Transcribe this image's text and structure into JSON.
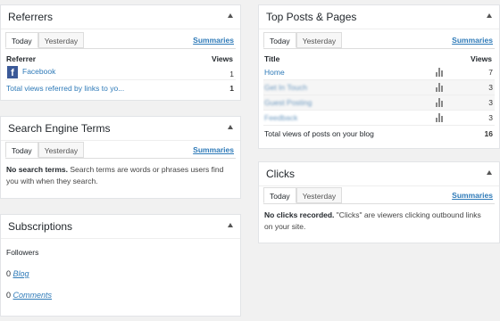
{
  "referrers": {
    "title": "Referrers",
    "tabs": [
      "Today",
      "Yesterday"
    ],
    "summaries": "Summaries",
    "col_referrer": "Referrer",
    "col_views": "Views",
    "rows": [
      {
        "label": "Facebook",
        "views": "1"
      }
    ],
    "total_label": "Total views referred by links to yo...",
    "total_value": "1"
  },
  "search_terms": {
    "title": "Search Engine Terms",
    "tabs": [
      "Today",
      "Yesterday"
    ],
    "summaries": "Summaries",
    "message_bold": "No search terms.",
    "message_rest": " Search terms are words or phrases users find you with when they search."
  },
  "subscriptions": {
    "title": "Subscriptions",
    "followers_label": "Followers",
    "items": [
      {
        "count": "0",
        "label": "Blog"
      },
      {
        "count": "0",
        "label": "Comments"
      }
    ]
  },
  "top_posts": {
    "title": "Top Posts & Pages",
    "tabs": [
      "Today",
      "Yesterday"
    ],
    "summaries": "Summaries",
    "col_title": "Title",
    "col_views": "Views",
    "rows": [
      {
        "label": "Home",
        "views": "7"
      },
      {
        "label": "Get In Touch",
        "views": "3"
      },
      {
        "label": "Guest Posting",
        "views": "3"
      },
      {
        "label": "Feedback",
        "views": "3"
      }
    ],
    "total_label": "Total views of posts on your blog",
    "total_value": "16"
  },
  "clicks": {
    "title": "Clicks",
    "tabs": [
      "Today",
      "Yesterday"
    ],
    "summaries": "Summaries",
    "message_bold": "No clicks recorded.",
    "message_rest": " \"Clicks\" are viewers clicking outbound links on your site."
  }
}
